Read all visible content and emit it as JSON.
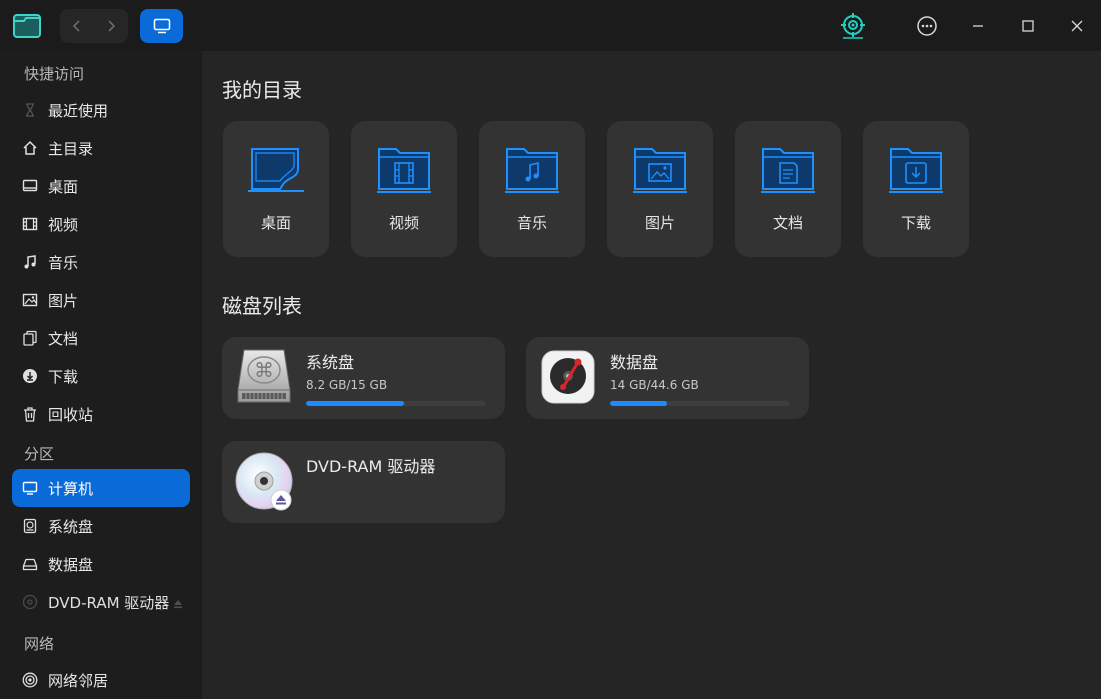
{
  "colors": {
    "accent": "#0a6bd8",
    "bar_fill": "#1a8cff",
    "folder_blue": "#1e90ff"
  },
  "titlebar": {
    "icons": [
      "file-manager-icon",
      "back-icon",
      "forward-icon",
      "computer-view-icon",
      "target-icon",
      "more-icon",
      "minimize-icon",
      "maximize-icon",
      "close-icon"
    ]
  },
  "sidebar": {
    "quick_access_title": "快捷访问",
    "quick_access": [
      {
        "label": "最近使用",
        "icon": "hourglass-icon"
      },
      {
        "label": "主目录",
        "icon": "home-icon"
      },
      {
        "label": "桌面",
        "icon": "desktop-icon"
      },
      {
        "label": "视频",
        "icon": "film-icon"
      },
      {
        "label": "音乐",
        "icon": "music-icon"
      },
      {
        "label": "图片",
        "icon": "image-icon"
      },
      {
        "label": "文档",
        "icon": "document-icon"
      },
      {
        "label": "下载",
        "icon": "download-icon"
      },
      {
        "label": "回收站",
        "icon": "trash-icon"
      }
    ],
    "partition_title": "分区",
    "partitions": [
      {
        "label": "计算机",
        "icon": "computer-icon",
        "active": true
      },
      {
        "label": "系统盘",
        "icon": "system-disk-icon"
      },
      {
        "label": "数据盘",
        "icon": "data-disk-icon"
      },
      {
        "label": "DVD-RAM 驱动器",
        "icon": "optical-disc-icon"
      }
    ],
    "network_title": "网络",
    "network": [
      {
        "label": "网络邻居",
        "icon": "network-icon"
      }
    ]
  },
  "main": {
    "my_dirs_title": "我的目录",
    "dirs": [
      {
        "label": "桌面",
        "icon": "desktop-folder-icon"
      },
      {
        "label": "视频",
        "icon": "video-folder-icon"
      },
      {
        "label": "音乐",
        "icon": "music-folder-icon"
      },
      {
        "label": "图片",
        "icon": "picture-folder-icon"
      },
      {
        "label": "文档",
        "icon": "document-folder-icon"
      },
      {
        "label": "下载",
        "icon": "download-folder-icon"
      }
    ],
    "disks_title": "磁盘列表",
    "disks": [
      {
        "name": "系统盘",
        "size": "8.2 GB/15 GB",
        "used_fraction": 0.547,
        "icon": "hard-drive-icon"
      },
      {
        "name": "数据盘",
        "size": "14 GB/44.6 GB",
        "used_fraction": 0.314,
        "icon": "disk-drive-icon"
      },
      {
        "name": "DVD-RAM 驱动器",
        "icon": "dvd-icon"
      }
    ]
  }
}
